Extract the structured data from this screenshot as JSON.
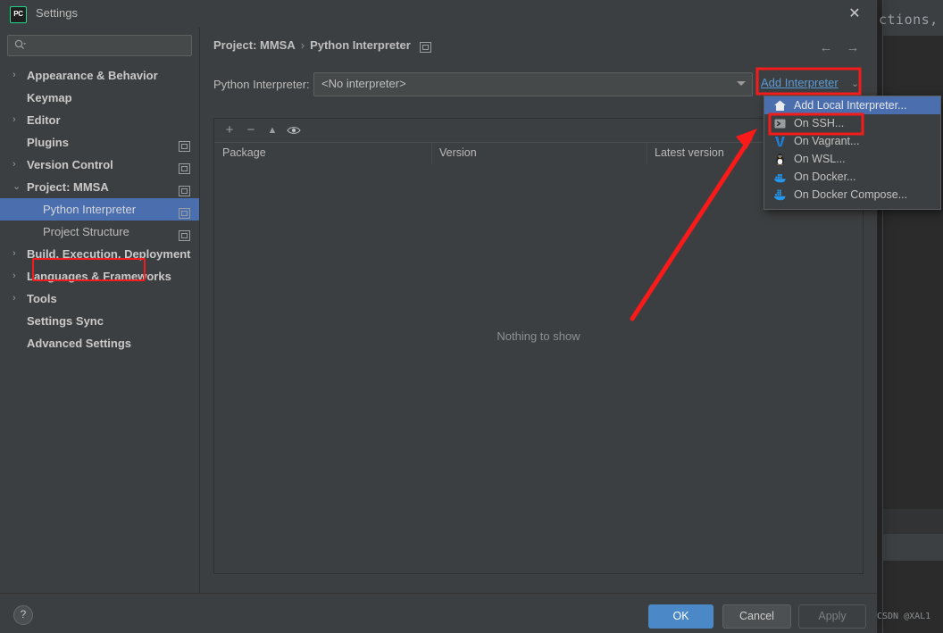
{
  "window": {
    "title": "Settings",
    "logo_text": "PC",
    "close_icon": "✕"
  },
  "background": {
    "editor_text": "ctions,"
  },
  "search": {
    "value": "",
    "placeholder": ""
  },
  "sidebar": {
    "items": [
      {
        "label": "Appearance & Behavior",
        "arrow": "›",
        "level": 1,
        "bold": true,
        "badge": false,
        "selected": false
      },
      {
        "label": "Keymap",
        "arrow": "",
        "level": 1,
        "bold": true,
        "badge": false,
        "selected": false
      },
      {
        "label": "Editor",
        "arrow": "›",
        "level": 1,
        "bold": true,
        "badge": false,
        "selected": false
      },
      {
        "label": "Plugins",
        "arrow": "",
        "level": 1,
        "bold": true,
        "badge": true,
        "selected": false
      },
      {
        "label": "Version Control",
        "arrow": "›",
        "level": 1,
        "bold": true,
        "badge": true,
        "selected": false
      },
      {
        "label": "Project: MMSA",
        "arrow": "⌄",
        "level": 1,
        "bold": true,
        "badge": true,
        "selected": false
      },
      {
        "label": "Python Interpreter",
        "arrow": "",
        "level": 2,
        "bold": false,
        "badge": true,
        "selected": true
      },
      {
        "label": "Project Structure",
        "arrow": "",
        "level": 2,
        "bold": false,
        "badge": true,
        "selected": false
      },
      {
        "label": "Build, Execution, Deployment",
        "arrow": "›",
        "level": 1,
        "bold": true,
        "badge": false,
        "selected": false
      },
      {
        "label": "Languages & Frameworks",
        "arrow": "›",
        "level": 1,
        "bold": true,
        "badge": false,
        "selected": false
      },
      {
        "label": "Tools",
        "arrow": "›",
        "level": 1,
        "bold": true,
        "badge": false,
        "selected": false
      },
      {
        "label": "Settings Sync",
        "arrow": "",
        "level": 1,
        "bold": true,
        "badge": false,
        "selected": false
      },
      {
        "label": "Advanced Settings",
        "arrow": "",
        "level": 1,
        "bold": true,
        "badge": false,
        "selected": false
      }
    ]
  },
  "content": {
    "breadcrumb_root": "Project: MMSA",
    "breadcrumb_sep": "›",
    "breadcrumb_leaf": "Python Interpreter",
    "nav_back": "←",
    "nav_forward": "→",
    "interpreter_label": "Python Interpreter:",
    "interpreter_value": "<No interpreter>",
    "add_interpreter_label": "Add Interpreter",
    "add_interpreter_chevron": "⌄"
  },
  "packages": {
    "toolbar": {
      "add": "+",
      "remove": "−",
      "upgrade": "▲",
      "show_early_releases": "◉"
    },
    "columns": [
      "Package",
      "Version",
      "Latest version"
    ],
    "rows": [],
    "empty_text": "Nothing to show"
  },
  "menu": {
    "items": [
      {
        "label": "Add Local Interpreter...",
        "icon": "home-icon",
        "highlighted": true
      },
      {
        "label": "On SSH...",
        "icon": "ssh-terminal-icon",
        "highlighted": false
      },
      {
        "label": "On Vagrant...",
        "icon": "vagrant-icon",
        "highlighted": false
      },
      {
        "label": "On WSL...",
        "icon": "wsl-penguin-icon",
        "highlighted": false
      },
      {
        "label": "On Docker...",
        "icon": "docker-whale-icon",
        "highlighted": false
      },
      {
        "label": "On Docker Compose...",
        "icon": "docker-compose-icon",
        "highlighted": false
      }
    ]
  },
  "footer": {
    "help": "?",
    "ok": "OK",
    "cancel": "Cancel",
    "apply": "Apply",
    "watermark": "CSDN @XAL1"
  },
  "colors": {
    "dialog_bg": "#3c3f41",
    "selection_blue": "#4b6eaf",
    "link_blue": "#5b9bd5",
    "ok_button": "#4a88c7",
    "annotation_red": "#f21c1c",
    "brand_green": "#21d789"
  }
}
